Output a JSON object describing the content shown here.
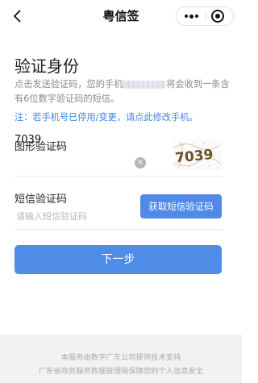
{
  "navbar": {
    "back_icon": "chevron-left-icon",
    "title": "粤信签",
    "more_icon": "more-dots-icon",
    "close_icon": "target-close-icon"
  },
  "verify": {
    "title": "验证身份",
    "desc_before": "点击发送验证码，您的手机",
    "desc_after": "将会收到一条含有6位数字验证码的短信。",
    "note": "注：若手机号已停用/变更，请点此修改手机。"
  },
  "captcha": {
    "label": "图形验证码",
    "value": "7039",
    "image_text": "7039",
    "clear_icon": "clear-circle-icon"
  },
  "sms": {
    "label": "短信验证码",
    "placeholder": "请输入短信验证码",
    "button_label": "获取短信验证码"
  },
  "next_button": "下一步",
  "footer": {
    "line1": "本服务由数字广东公司提供技术支持",
    "line2": "广东省政务服务数据管理局保障您的个人信息安全"
  },
  "colors": {
    "accent": "#4f8ce8",
    "note_blue": "#3f86e6",
    "footer_bg": "#f2f2f2"
  }
}
